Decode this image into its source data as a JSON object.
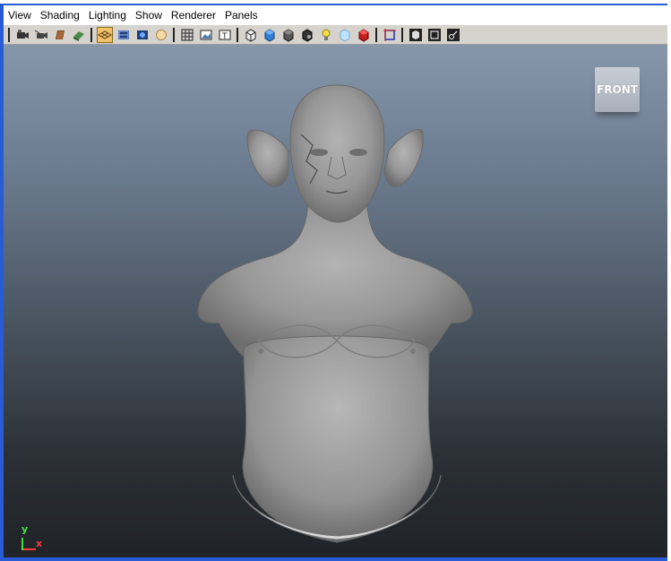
{
  "menu": {
    "items": [
      "View",
      "Shading",
      "Lighting",
      "Show",
      "Renderer",
      "Panels"
    ]
  },
  "toolbar": {
    "icons": [
      "camera-select-icon",
      "camera-attributes-icon",
      "bookmarks-icon",
      "image-plane-icon",
      "grid-icon",
      "wireframe-icon",
      "smooth-shade-icon",
      "flat-shade-icon",
      "bounding-box-icon",
      "textured-icon",
      "wireframe-on-shaded-icon",
      "xray-icon",
      "use-lights-icon",
      "shadows-icon",
      "screen-space-ao-icon",
      "motion-blur-icon",
      "resolution-gate-icon",
      "gate-mask-icon",
      "field-chart-icon",
      "safe-action-icon",
      "isolate-select-icon"
    ],
    "active_index": 4
  },
  "viewport": {
    "viewcube_label": "FRONT",
    "axis_y": "y",
    "axis_x": "x"
  },
  "colors": {
    "accent": "#2a5bd7",
    "toolbar_bg": "#d6d3ce",
    "viewport_top": "#8797ab",
    "viewport_bottom": "#1f2327",
    "model": "#9a9a9a"
  }
}
